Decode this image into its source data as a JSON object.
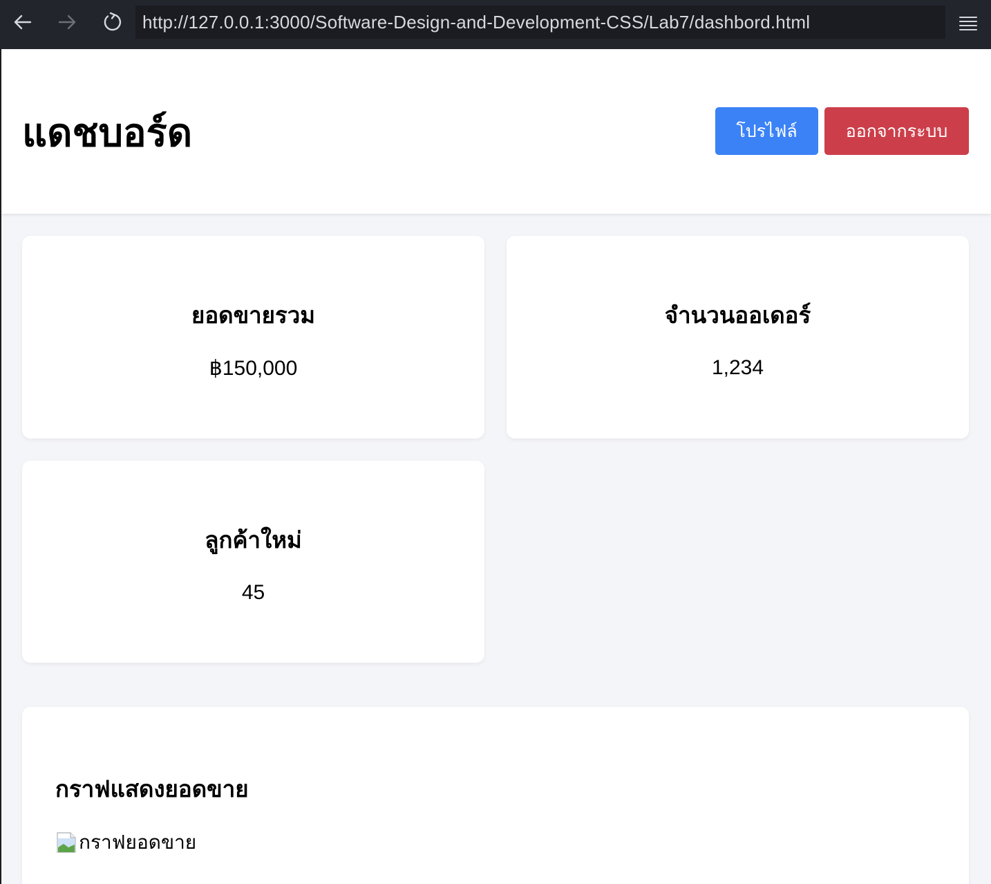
{
  "browser": {
    "url": "http://127.0.0.1:3000/Software-Design-and-Development-CSS/Lab7/dashbord.html",
    "icons": [
      "back-arrow-icon",
      "forward-arrow-icon",
      "reload-icon",
      "menu-icon"
    ]
  },
  "header": {
    "title": "แดชบอร์ด",
    "profile_button": "โปรไฟล์",
    "logout_button": "ออกจากระบบ"
  },
  "stats": [
    {
      "label": "ยอดขายรวม",
      "value": "฿150,000"
    },
    {
      "label": "จำนวนออเดอร์",
      "value": "1,234"
    },
    {
      "label": "ลูกค้าใหม่",
      "value": "45"
    }
  ],
  "chart_section": {
    "title": "กราฟแสดงยอดขาย",
    "image_alt": "กราฟยอดขาย"
  },
  "colors": {
    "browser_bar": "#22252c",
    "primary": "#3b82f6",
    "danger": "#cc3f4a",
    "page_bg": "#f4f5f9"
  }
}
